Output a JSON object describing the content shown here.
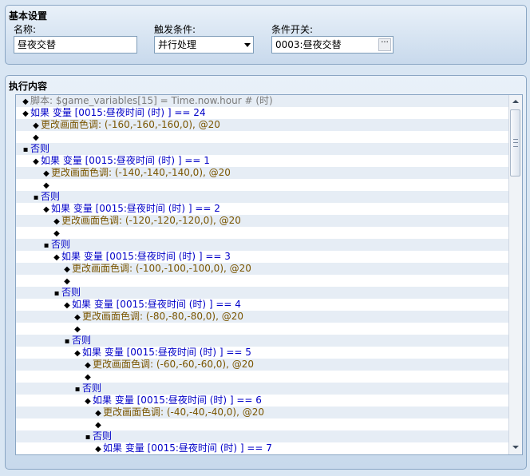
{
  "basic": {
    "title": "基本设置",
    "name_label": "名称:",
    "name_value": "昼夜交替",
    "trigger_label": "触发条件:",
    "trigger_value": "并行处理",
    "switch_label": "条件开关:",
    "switch_value": "0003:昼夜交替",
    "switch_button": "···"
  },
  "exec": {
    "title": "执行内容",
    "rows": [
      {
        "indent": 0,
        "marker": "◆",
        "text": "脚本: $game_variables[15] = Time.now.hour # (时)",
        "kind": "comment"
      },
      {
        "indent": 0,
        "marker": "◆",
        "text": "如果 变量 [0015:昼夜时间 (时) ] == 24",
        "kind": "branch"
      },
      {
        "indent": 1,
        "marker": "◆",
        "text": "更改画面色调: (-160,-160,-160,0), @20",
        "kind": "tone"
      },
      {
        "indent": 1,
        "marker": "◆",
        "text": "",
        "kind": "plain"
      },
      {
        "indent": 0,
        "marker": "▪",
        "text": "否则",
        "kind": "branch"
      },
      {
        "indent": 1,
        "marker": "◆",
        "text": "如果 变量 [0015:昼夜时间 (时) ] == 1",
        "kind": "branch"
      },
      {
        "indent": 2,
        "marker": "◆",
        "text": "更改画面色调: (-140,-140,-140,0), @20",
        "kind": "tone"
      },
      {
        "indent": 2,
        "marker": "◆",
        "text": "",
        "kind": "plain"
      },
      {
        "indent": 1,
        "marker": "▪",
        "text": "否则",
        "kind": "branch"
      },
      {
        "indent": 2,
        "marker": "◆",
        "text": "如果 变量 [0015:昼夜时间 (时) ] == 2",
        "kind": "branch"
      },
      {
        "indent": 3,
        "marker": "◆",
        "text": "更改画面色调: (-120,-120,-120,0), @20",
        "kind": "tone"
      },
      {
        "indent": 3,
        "marker": "◆",
        "text": "",
        "kind": "plain"
      },
      {
        "indent": 2,
        "marker": "▪",
        "text": "否则",
        "kind": "branch"
      },
      {
        "indent": 3,
        "marker": "◆",
        "text": "如果 变量 [0015:昼夜时间 (时) ] == 3",
        "kind": "branch"
      },
      {
        "indent": 4,
        "marker": "◆",
        "text": "更改画面色调: (-100,-100,-100,0), @20",
        "kind": "tone"
      },
      {
        "indent": 4,
        "marker": "◆",
        "text": "",
        "kind": "plain"
      },
      {
        "indent": 3,
        "marker": "▪",
        "text": "否则",
        "kind": "branch"
      },
      {
        "indent": 4,
        "marker": "◆",
        "text": "如果 变量 [0015:昼夜时间 (时) ] == 4",
        "kind": "branch"
      },
      {
        "indent": 5,
        "marker": "◆",
        "text": "更改画面色调: (-80,-80,-80,0), @20",
        "kind": "tone"
      },
      {
        "indent": 5,
        "marker": "◆",
        "text": "",
        "kind": "plain"
      },
      {
        "indent": 4,
        "marker": "▪",
        "text": "否则",
        "kind": "branch"
      },
      {
        "indent": 5,
        "marker": "◆",
        "text": "如果 变量 [0015:昼夜时间 (时) ] == 5",
        "kind": "branch"
      },
      {
        "indent": 6,
        "marker": "◆",
        "text": "更改画面色调: (-60,-60,-60,0), @20",
        "kind": "tone"
      },
      {
        "indent": 6,
        "marker": "◆",
        "text": "",
        "kind": "plain"
      },
      {
        "indent": 5,
        "marker": "▪",
        "text": "否则",
        "kind": "branch"
      },
      {
        "indent": 6,
        "marker": "◆",
        "text": "如果 变量 [0015:昼夜时间 (时) ] == 6",
        "kind": "branch"
      },
      {
        "indent": 7,
        "marker": "◆",
        "text": "更改画面色调: (-40,-40,-40,0), @20",
        "kind": "tone"
      },
      {
        "indent": 7,
        "marker": "◆",
        "text": "",
        "kind": "plain"
      },
      {
        "indent": 6,
        "marker": "▪",
        "text": "否则",
        "kind": "branch"
      },
      {
        "indent": 7,
        "marker": "◆",
        "text": "如果 变量 [0015:昼夜时间 (时) ] == 7",
        "kind": "branch"
      }
    ]
  },
  "colors": {
    "panel_bg": "#d9e6f3",
    "comment": "#7a7a7a",
    "branch": "#0000c8",
    "tone": "#7a5500"
  },
  "icons": {
    "dropdown": "chevron-down-icon",
    "browse": "ellipsis-icon",
    "scroll_up": "arrow-up-icon",
    "scroll_down": "arrow-down-icon"
  }
}
